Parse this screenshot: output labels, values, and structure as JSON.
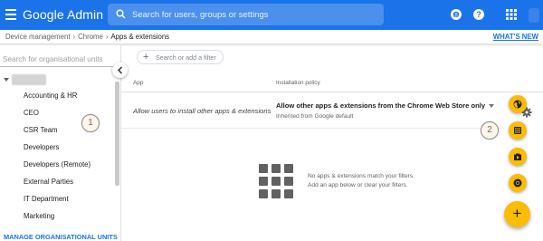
{
  "header": {
    "brand": "Google Admin",
    "search_placeholder": "Search for users, groups or settings"
  },
  "breadcrumb": {
    "items": [
      "Device management",
      "Chrome",
      "Apps & extensions"
    ],
    "whats_new": "WHAT'S NEW"
  },
  "org_panel": {
    "search_placeholder": "Search for organisational units",
    "units": [
      "Accounting & HR",
      "CEO",
      "CSR Team",
      "Developers",
      "Developers (Remote)",
      "External Parties",
      "IT Department",
      "Marketing"
    ],
    "manage_label": "MANAGE ORGANISATIONAL UNITS"
  },
  "main": {
    "filter_placeholder": "Search or add a filter",
    "columns": {
      "app": "App",
      "policy": "Installation policy"
    },
    "row": {
      "app": "Allow users to install other apps & extensions",
      "policy": "Allow other apps & extensions from the Chrome Web Store only",
      "inherited": "Inherited from Google default"
    },
    "empty_line1": "No apps & extensions match your filters.",
    "empty_line2": "Add an app below or clear your filters."
  },
  "callouts": [
    "1",
    "2"
  ],
  "fab": {
    "small_buttons": [
      "globe-icon",
      "grid-icon",
      "play-store-icon",
      "chrome-icon"
    ],
    "main_icon": "plus-icon"
  },
  "colors": {
    "appbar": "#1a73e8",
    "accent": "#fbbc04",
    "link": "#1a73e8"
  }
}
